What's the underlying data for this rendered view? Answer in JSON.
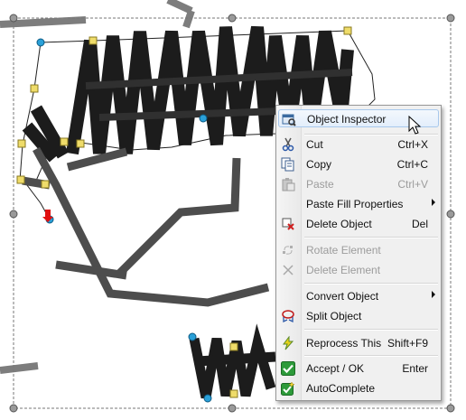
{
  "colors": {
    "stroke_dark": "#1c1c1c",
    "stroke_gray": "#505050",
    "stroke_light": "#7d7d7d",
    "node_blue": "#2aa0d8",
    "node_yellow": "#efdc6a",
    "handle_gray": "#9a9a9a",
    "menu_bg": "#f0f0f0",
    "menu_highlight": "#e3eefb",
    "disabled_text": "#9c9c9c"
  },
  "context_menu": {
    "items": [
      {
        "id": "object-inspector",
        "label": "Object Inspector",
        "shortcut": "",
        "icon": "inspector-icon",
        "enabled": true,
        "highlighted": true,
        "submenu": false
      },
      {
        "separator": true
      },
      {
        "id": "cut",
        "label": "Cut",
        "shortcut": "Ctrl+X",
        "icon": "scissors-icon",
        "enabled": true,
        "submenu": false
      },
      {
        "id": "copy",
        "label": "Copy",
        "shortcut": "Ctrl+C",
        "icon": "copy-icon",
        "enabled": true,
        "submenu": false
      },
      {
        "id": "paste",
        "label": "Paste",
        "shortcut": "Ctrl+V",
        "icon": "paste-icon",
        "enabled": false,
        "submenu": false
      },
      {
        "id": "paste-fill-properties",
        "label": "Paste Fill Properties",
        "shortcut": "",
        "icon": "",
        "enabled": true,
        "submenu": true
      },
      {
        "id": "delete-object",
        "label": "Delete Object",
        "shortcut": "Del",
        "icon": "delete-object-icon",
        "enabled": true,
        "submenu": false
      },
      {
        "separator": true
      },
      {
        "id": "rotate-element",
        "label": "Rotate Element",
        "shortcut": "",
        "icon": "rotate-element-icon",
        "enabled": false,
        "submenu": false
      },
      {
        "id": "delete-element",
        "label": "Delete Element",
        "shortcut": "",
        "icon": "delete-element-icon",
        "enabled": false,
        "submenu": false
      },
      {
        "separator": true
      },
      {
        "id": "convert-object",
        "label": "Convert Object",
        "shortcut": "",
        "icon": "",
        "enabled": true,
        "submenu": true
      },
      {
        "id": "split-object",
        "label": "Split Object",
        "shortcut": "",
        "icon": "split-object-icon",
        "enabled": true,
        "submenu": false
      },
      {
        "separator": true
      },
      {
        "id": "reprocess-this",
        "label": "Reprocess This",
        "shortcut": "Shift+F9",
        "icon": "lightning-icon",
        "enabled": true,
        "submenu": false
      },
      {
        "separator": true
      },
      {
        "id": "accept-ok",
        "label": "Accept / OK",
        "shortcut": "Enter",
        "icon": "checkmark-icon",
        "enabled": true,
        "submenu": false
      },
      {
        "id": "autocomplete",
        "label": "AutoComplete",
        "shortcut": "",
        "icon": "autocomplete-icon",
        "enabled": true,
        "submenu": false
      }
    ]
  }
}
